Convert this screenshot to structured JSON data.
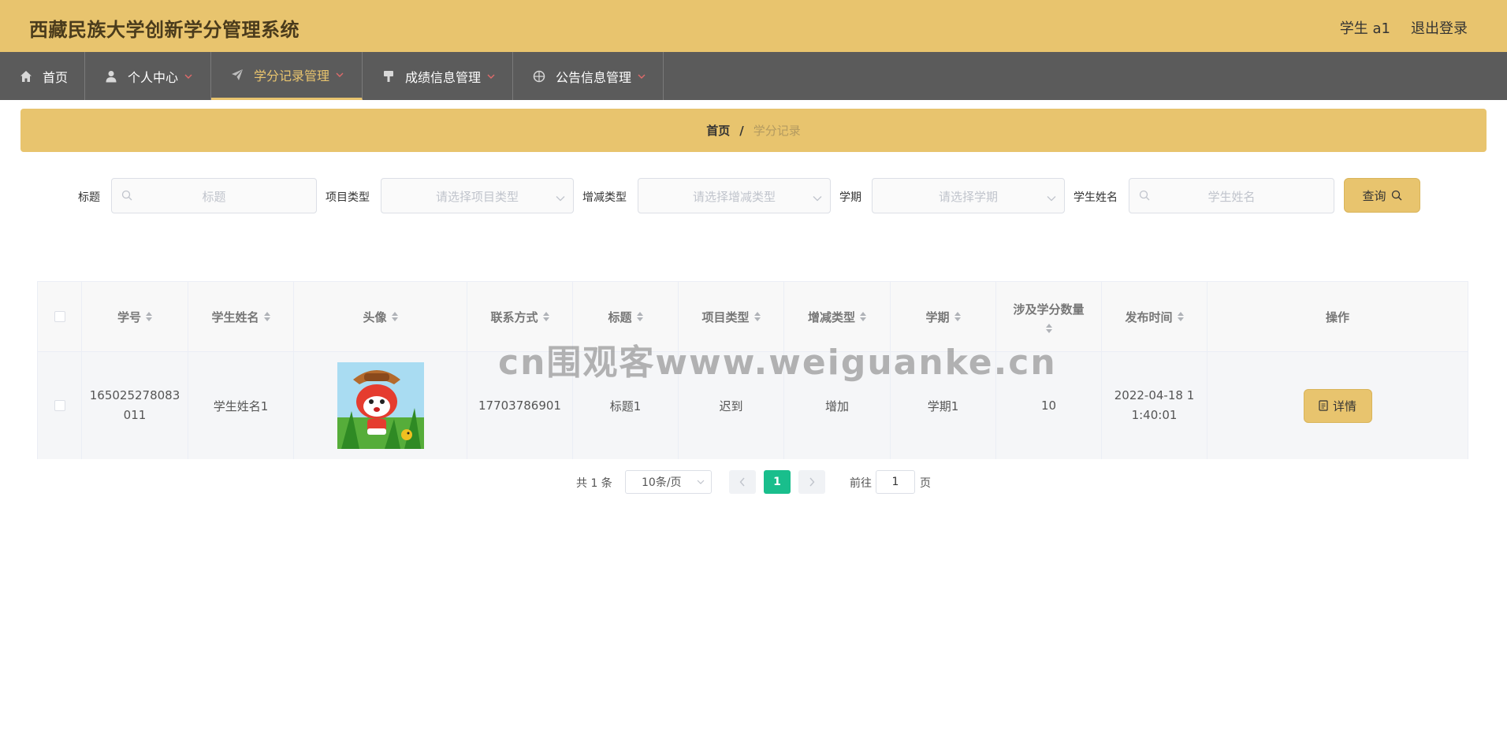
{
  "header": {
    "title": "西藏民族大学创新学分管理系统",
    "user": "学生 a1",
    "logout": "退出登录"
  },
  "nav": {
    "items": [
      {
        "label": "首页",
        "icon": "home-icon"
      },
      {
        "label": "个人中心",
        "icon": "user-icon"
      },
      {
        "label": "学分记录管理",
        "icon": "paper-plane-icon",
        "active": true
      },
      {
        "label": "成绩信息管理",
        "icon": "brush-icon"
      },
      {
        "label": "公告信息管理",
        "icon": "compass-icon"
      }
    ]
  },
  "breadcrumb": {
    "home": "首页",
    "separator": "/",
    "current": "学分记录"
  },
  "filters": {
    "title": {
      "label": "标题",
      "placeholder": "标题"
    },
    "project_type": {
      "label": "项目类型",
      "placeholder": "请选择项目类型"
    },
    "change_type": {
      "label": "增减类型",
      "placeholder": "请选择增减类型"
    },
    "term": {
      "label": "学期",
      "placeholder": "请选择学期"
    },
    "student_name": {
      "label": "学生姓名",
      "placeholder": "学生姓名"
    },
    "query_label": "查询"
  },
  "table": {
    "columns": [
      "学号",
      "学生姓名",
      "头像",
      "联系方式",
      "标题",
      "项目类型",
      "增减类型",
      "学期",
      "涉及学分数量",
      "发布时间",
      "操作"
    ],
    "rows": [
      {
        "student_id_line1": "165025278083",
        "student_id_line2": "011",
        "student_name": "学生姓名1",
        "phone": "17703786901",
        "title": "标题1",
        "project_type": "迟到",
        "change_type": "增加",
        "term": "学期1",
        "credits": "10",
        "time_line1": "2022-04-18 1",
        "time_line2": "1:40:01",
        "action": "详情"
      }
    ]
  },
  "pagination": {
    "total": "共 1 条",
    "page_size": "10条/页",
    "current_page": "1",
    "goto_label": "前往",
    "goto_value": "1",
    "page_suffix": "页"
  },
  "watermark": "cn围观客www.weiguanke.cn",
  "colors": {
    "primary": "#e8c46e",
    "nav_bg": "#5b5b5b",
    "page_active": "#19be8c"
  }
}
